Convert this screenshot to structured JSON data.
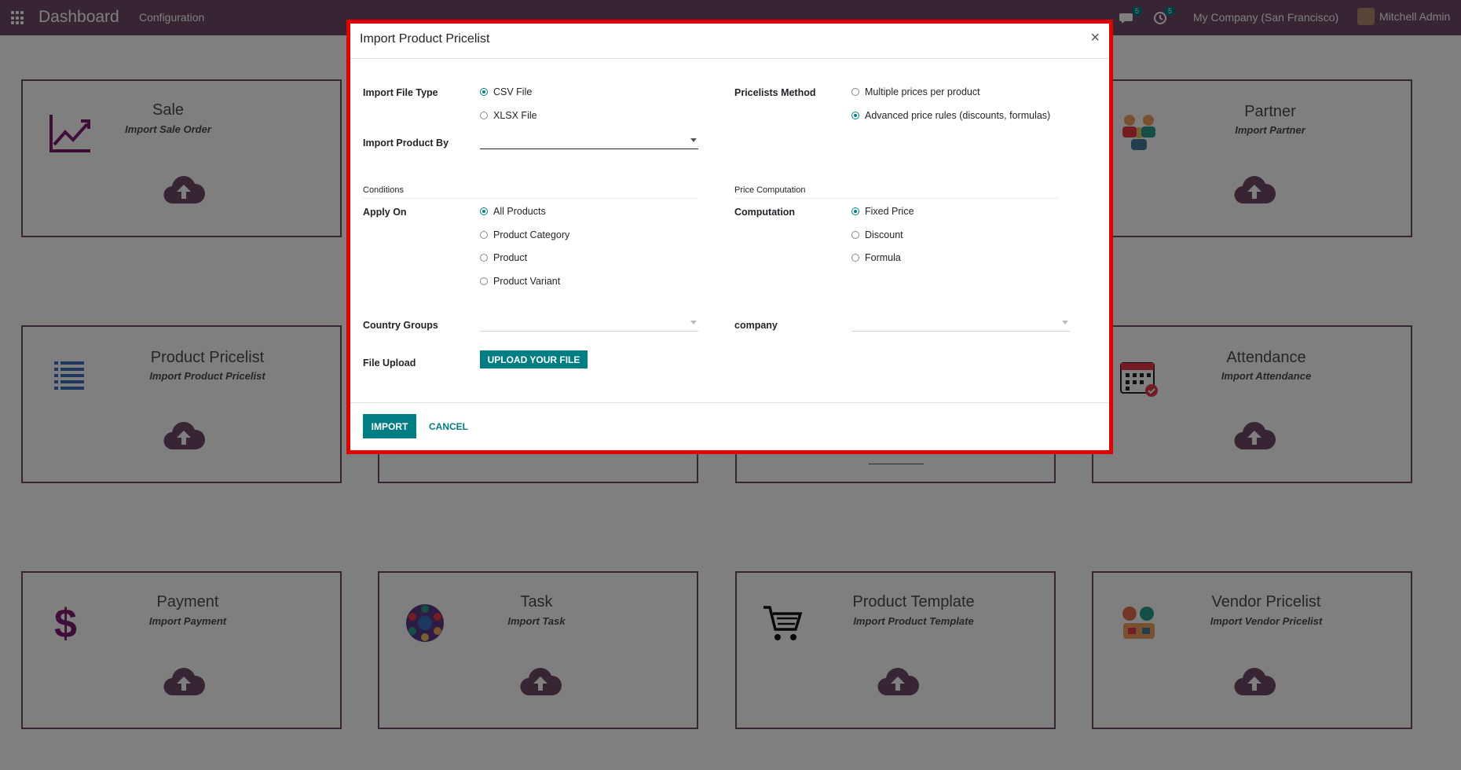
{
  "navbar": {
    "brand": "Dashboard",
    "menu": "Configuration",
    "chat_count": "5",
    "activity_count": "5",
    "company": "My Company (San Francisco)",
    "user": "Mitchell Admin"
  },
  "cards": [
    {
      "title": "Sale",
      "subtitle": "Import Sale Order",
      "icon": "sale-chart-icon"
    },
    {
      "title": "Partner",
      "subtitle": "Import Partner",
      "icon": "partner-people-icon"
    },
    {
      "title": "Product Pricelist",
      "subtitle": "Import Product Pricelist",
      "icon": "pricelist-list-icon"
    },
    {
      "title": "Attendance",
      "subtitle": "Import Attendance",
      "icon": "attendance-calendar-icon"
    },
    {
      "title": "Payment",
      "subtitle": "Import Payment",
      "icon": "dollar-icon"
    },
    {
      "title": "Task",
      "subtitle": "Import Task",
      "icon": "task-network-icon"
    },
    {
      "title": "Product Template",
      "subtitle": "Import Product Template",
      "icon": "cart-icon"
    },
    {
      "title": "Vendor Pricelist",
      "subtitle": "Import Vendor Pricelist",
      "icon": "vendor-icon"
    }
  ],
  "modal": {
    "title": "Import Product Pricelist",
    "close": "×",
    "file_type_label": "Import File Type",
    "file_types": [
      "CSV File",
      "XLSX File"
    ],
    "file_type_selected": "CSV File",
    "product_by_label": "Import Product By",
    "product_by_value": "",
    "method_label": "Pricelists Method",
    "methods": [
      "Multiple prices per product",
      "Advanced price rules (discounts, formulas)"
    ],
    "method_selected": "Advanced price rules (discounts, formulas)",
    "conditions_title": "Conditions",
    "apply_on_label": "Apply On",
    "apply_on": [
      "All Products",
      "Product Category",
      "Product",
      "Product Variant"
    ],
    "apply_on_selected": "All Products",
    "price_computation_title": "Price Computation",
    "computation_label": "Computation",
    "computations": [
      "Fixed Price",
      "Discount",
      "Formula"
    ],
    "computation_selected": "Fixed Price",
    "country_groups_label": "Country Groups",
    "company_label": "company",
    "file_upload_label": "File Upload",
    "upload_button": "Upload your file",
    "import_button": "Import",
    "cancel_button": "Cancel"
  },
  "colors": {
    "navbar": "#714B67",
    "accent": "#017e84",
    "highlight_border": "#e00000"
  }
}
